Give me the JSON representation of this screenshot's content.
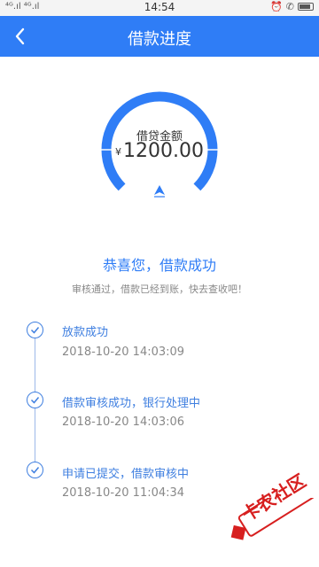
{
  "status_bar": {
    "signal_text": "⁴ᴳ.ıl ⁴ᴳ.ıl",
    "time": "14:54"
  },
  "app_bar": {
    "title": "借款进度",
    "back_icon": "chevron-left-icon"
  },
  "gauge": {
    "label": "借贷金额",
    "currency": "¥",
    "amount": "1200.00",
    "color": "#2f7df6"
  },
  "result": {
    "title": "恭喜您，借款成功",
    "subtitle": "审核通过，借款已经到账，快去查收吧！"
  },
  "timeline": [
    {
      "label": "放款成功",
      "time": "2018-10-20 14:03:09"
    },
    {
      "label": "借款审核成功，银行处理中",
      "time": "2018-10-20 14:03:06"
    },
    {
      "label": "申请已提交，借款审核中",
      "time": "2018-10-20 11:04:34"
    }
  ],
  "watermark": {
    "text": "卡农社区"
  },
  "colors": {
    "primary": "#2f7df6",
    "timeline": "#3f7fe0",
    "muted": "#888888"
  }
}
